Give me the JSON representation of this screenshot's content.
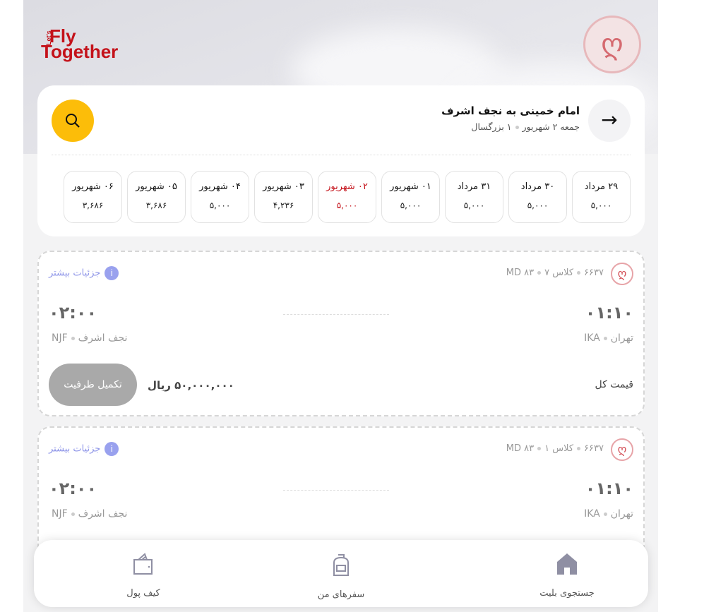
{
  "brand": {
    "logo_lets": "Let's",
    "logo_fly": "Fly",
    "logo_together": "Together"
  },
  "search": {
    "title": "امام خمینی به نجف اشرف",
    "date": "جمعه ۲ شهریور",
    "passengers": "۱ بزرگسال"
  },
  "dates": [
    {
      "label": "۲۹ مرداد",
      "price": "۵,۰۰۰",
      "selected": false
    },
    {
      "label": "۳۰ مرداد",
      "price": "۵,۰۰۰",
      "selected": false
    },
    {
      "label": "۳۱ مرداد",
      "price": "۵,۰۰۰",
      "selected": false
    },
    {
      "label": "۰۱ شهریور",
      "price": "۵,۰۰۰",
      "selected": false
    },
    {
      "label": "۰۲ شهریور",
      "price": "۵,۰۰۰",
      "selected": true
    },
    {
      "label": "۰۳ شهریور",
      "price": "۴,۲۳۶",
      "selected": false
    },
    {
      "label": "۰۴ شهریور",
      "price": "۵,۰۰۰",
      "selected": false
    },
    {
      "label": "۰۵ شهریور",
      "price": "۳,۶۸۶",
      "selected": false
    },
    {
      "label": "۰۶ شهریور",
      "price": "۳,۶۸۶",
      "selected": false
    }
  ],
  "flights": [
    {
      "number": "۶۶۳۷",
      "class": "کلاس ۷",
      "aircraft": "MD ۸۳",
      "details": "جزئیات بیشتر",
      "dep_time": "۰۱:۱۰",
      "arr_time": "۰۲:۰۰",
      "origin_city": "تهران",
      "origin_code": "IKA",
      "dest_city": "نجف اشرف",
      "dest_code": "NJF",
      "price_label": "قیمت کل",
      "price": "۵۰,۰۰۰,۰۰۰ ریال",
      "status": "تکمیل ظرفیت"
    },
    {
      "number": "۶۶۳۷",
      "class": "کلاس ۱",
      "aircraft": "MD ۸۳",
      "details": "جزئیات بیشتر",
      "dep_time": "۰۱:۱۰",
      "arr_time": "۰۲:۰۰",
      "origin_city": "تهران",
      "origin_code": "IKA",
      "dest_city": "نجف اشرف",
      "dest_code": "NJF"
    }
  ],
  "nav": {
    "search": "جستجوی بلیت",
    "trips": "سفرهای من",
    "wallet": "کیف پول"
  },
  "colors": {
    "accent": "#fcbd09",
    "brand": "#c4121a",
    "link": "#8e95e8"
  }
}
